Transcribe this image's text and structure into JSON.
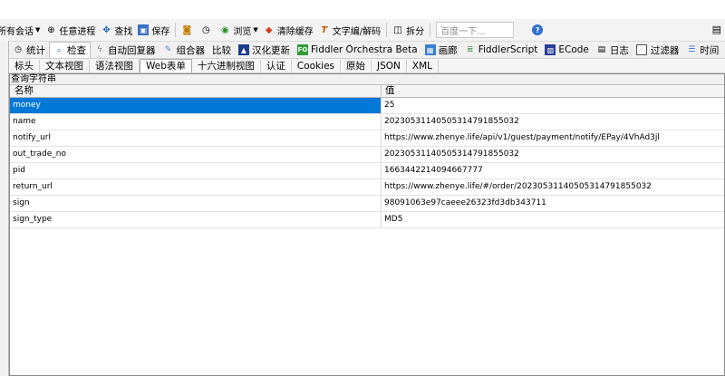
{
  "toolbar": {
    "items": [
      {
        "label": "所有会话",
        "icon": "remove-sessions-icon"
      },
      {
        "label": "任意进程",
        "icon": "crosshair-icon"
      },
      {
        "label": "查找",
        "icon": "binoculars-icon"
      },
      {
        "label": "保存",
        "icon": "save-icon"
      },
      {
        "label": "",
        "icon": "screenshot-icon"
      },
      {
        "label": "",
        "icon": "timer-icon"
      },
      {
        "label": "浏览",
        "icon": "browse-icon"
      },
      {
        "label": "清除缓存",
        "icon": "clear-cache-icon"
      },
      {
        "label": "文字编/解码",
        "icon": "text-wizard-icon"
      },
      {
        "label": "拆分",
        "icon": "split-icon"
      }
    ],
    "search_placeholder": "百度一下..."
  },
  "tabs": [
    {
      "label": "统计",
      "icon": "stopwatch-icon"
    },
    {
      "label": "检查",
      "icon": "inspect-icon",
      "active": true
    },
    {
      "label": "自动回复器",
      "icon": "lightning-icon"
    },
    {
      "label": "组合器",
      "icon": "composer-icon"
    },
    {
      "label": "比较",
      "icon": ""
    },
    {
      "label": "汉化更新",
      "icon": "update-icon"
    },
    {
      "label": "Fiddler Orchestra Beta",
      "icon": "fo-icon"
    },
    {
      "label": "画廊",
      "icon": "gallery-icon"
    },
    {
      "label": "FiddlerScript",
      "icon": "script-icon"
    },
    {
      "label": "ECode",
      "icon": "ecode-icon"
    },
    {
      "label": "日志",
      "icon": "log-icon"
    },
    {
      "label": "过滤器",
      "icon": "filter-checkbox-icon"
    },
    {
      "label": "时间",
      "icon": "timeline-icon"
    }
  ],
  "subtabs": [
    {
      "label": "标头"
    },
    {
      "label": "文本视图"
    },
    {
      "label": "语法视图"
    },
    {
      "label": "Web表单",
      "active": true
    },
    {
      "label": "十六进制视图"
    },
    {
      "label": "认证"
    },
    {
      "label": "Cookies"
    },
    {
      "label": "原始"
    },
    {
      "label": "JSON"
    },
    {
      "label": "XML"
    }
  ],
  "panel": {
    "title": "查询字符串",
    "col_name": "名称",
    "col_value": "值",
    "rows": [
      {
        "name": "money",
        "value": "25"
      },
      {
        "name": "name",
        "value": "20230531140505314791855032"
      },
      {
        "name": "notify_url",
        "value": "https://www.zhenye.life/api/v1/guest/payment/notify/EPay/4VhAd3jl"
      },
      {
        "name": "out_trade_no",
        "value": "20230531140505314791855032"
      },
      {
        "name": "pid",
        "value": "1663442214094667777"
      },
      {
        "name": "return_url",
        "value": "https://www.zhenye.life/#/order/20230531140505314791855032"
      },
      {
        "name": "sign",
        "value": "98091063e97caeee26323fd3db343711"
      },
      {
        "name": "sign_type",
        "value": "MD5"
      }
    ]
  },
  "colors": {
    "selected_row": "#0078d7",
    "toolbar_bg": "#f3f3f3"
  }
}
